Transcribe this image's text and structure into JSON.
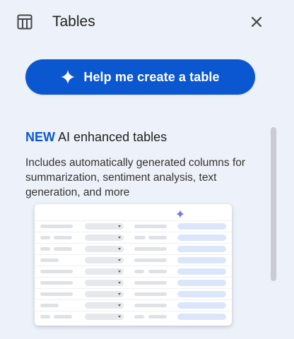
{
  "header": {
    "title": "Tables",
    "icon": "table-icon",
    "close_icon": "close-icon"
  },
  "help_button": {
    "label": "Help me create a table",
    "icon": "sparkle-icon",
    "color": "#0b57d0"
  },
  "promo": {
    "new_badge": "NEW",
    "title": "AI enhanced tables",
    "description": "Includes automatically generated columns for summarization, sentiment analysis, text generation, and more"
  },
  "preview": {
    "icon": "sparkle-icon",
    "accent": "#dce6fb"
  },
  "colors": {
    "panel_background": "#edf1f9",
    "accent_blue": "#0b57d0"
  }
}
